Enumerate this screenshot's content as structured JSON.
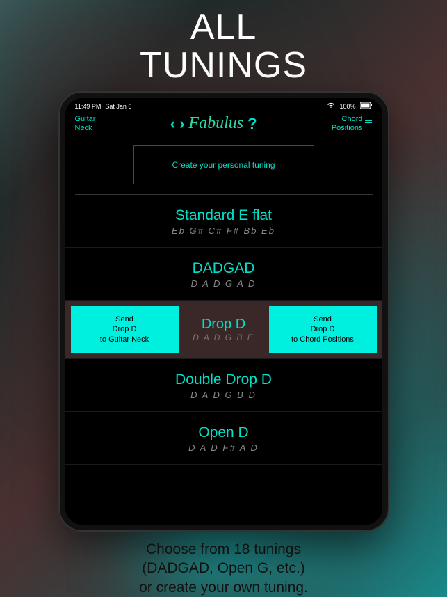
{
  "promo": {
    "title_line1": "ALL",
    "title_line2": "TUNINGS",
    "footer_line1": "Choose from 18 tunings",
    "footer_line2": "(DADGAD, Open G, etc.)",
    "footer_line3": "or create your own tuning."
  },
  "status": {
    "time": "11:49 PM",
    "date": "Sat Jan 6",
    "wifi": "100%"
  },
  "header": {
    "left_nav_line1": "Guitar",
    "left_nav_line2": "Neck",
    "app_name": "Fabulus",
    "help": "?",
    "arrow_left": "‹",
    "arrow_right": "›",
    "right_nav_line1": "Chord",
    "right_nav_line2": "Positions"
  },
  "create_label": "Create your personal tuning",
  "tunings": [
    {
      "name": "Standard E flat",
      "notes": "Eb G# C# F# Bb Eb"
    },
    {
      "name": "DADGAD",
      "notes": "D A D G A D"
    },
    {
      "name": "Drop D",
      "notes": "D A D G B E"
    },
    {
      "name": "Double Drop D",
      "notes": "D A D G B D"
    },
    {
      "name": "Open D",
      "notes": "D A D F# A D"
    }
  ],
  "selected": {
    "send_left_line1": "Send",
    "send_left_line2": "Drop D",
    "send_left_line3": "to Guitar Neck",
    "send_right_line1": "Send",
    "send_right_line2": "Drop D",
    "send_right_line3": "to Chord Positions"
  }
}
